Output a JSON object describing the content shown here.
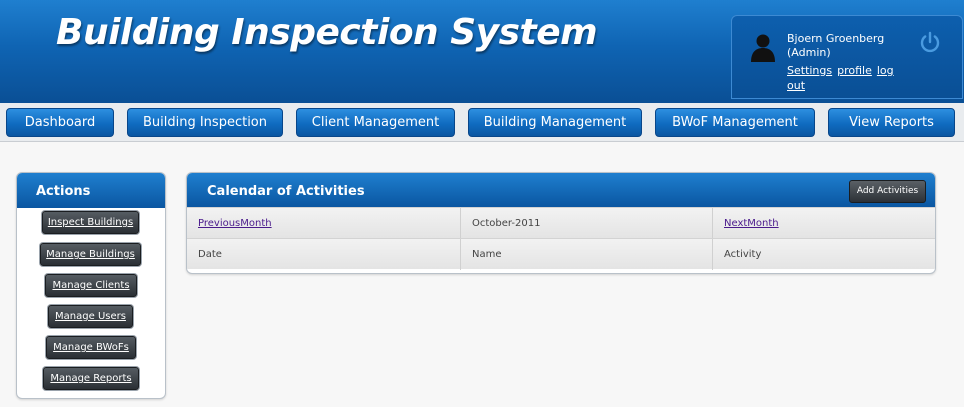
{
  "header": {
    "title": "Building Inspection System",
    "user": {
      "name": "Bjoern Groenberg",
      "role": "(Admin)",
      "links": [
        "Settings",
        "profile",
        "log out"
      ]
    }
  },
  "nav": {
    "items": [
      "Dashboard",
      "Building Inspection",
      "Client Management",
      "Building Management",
      "BWoF Management",
      "View Reports"
    ]
  },
  "actions": {
    "title": "Actions",
    "items": [
      "Inspect Buildings",
      "Manage Buildings",
      "Manage Clients",
      "Manage Users",
      "Manage BWoFs",
      "Manage Reports"
    ]
  },
  "calendar": {
    "title": "Calendar of Activities",
    "add_label": "Add Activities",
    "prev_label": "PreviousMonth",
    "month": "October-2011",
    "next_label": "NextMonth",
    "columns": [
      "Date",
      "Name",
      "Activity"
    ]
  },
  "colors": {
    "header_blue": "#0f64b3",
    "link_purple": "#4a1a8c",
    "dark_button": "#2a2f34"
  },
  "icons": [
    "user-avatar-icon",
    "power-icon"
  ]
}
